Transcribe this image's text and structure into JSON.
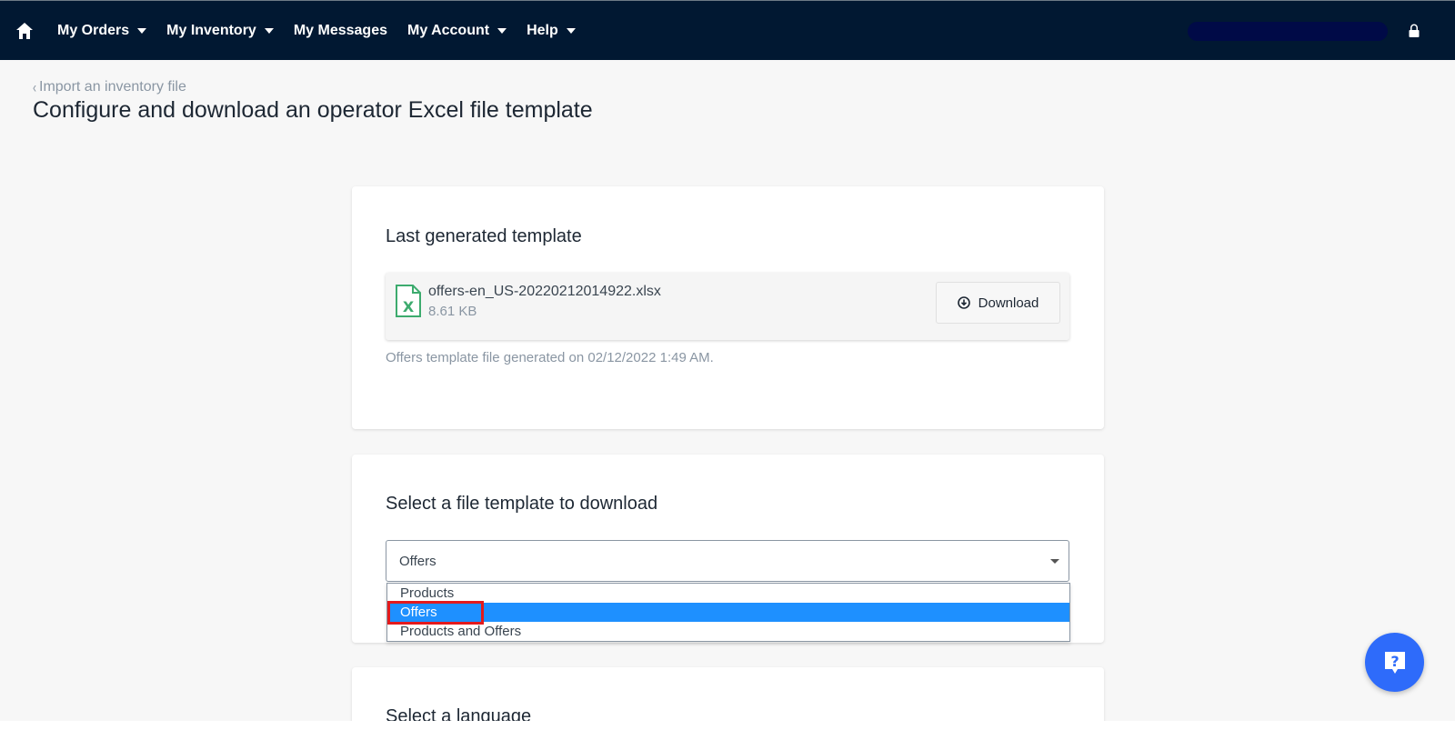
{
  "nav": {
    "items": [
      {
        "label": "My Orders",
        "dropdown": true
      },
      {
        "label": "My Inventory",
        "dropdown": true
      },
      {
        "label": "My Messages",
        "dropdown": false
      },
      {
        "label": "My Account",
        "dropdown": true
      },
      {
        "label": "Help",
        "dropdown": true
      }
    ]
  },
  "breadcrumb": {
    "back_label": "Import an inventory file"
  },
  "page": {
    "title": "Configure and download an operator Excel file template"
  },
  "last_template": {
    "title": "Last generated template",
    "file_name": "offers-en_US-20220212014922.xlsx",
    "file_size": "8.61 KB",
    "download_label": "Download",
    "generated_note": "Offers template file generated on 02/12/2022 1:49 AM."
  },
  "template_select": {
    "title": "Select a file template to download",
    "selected": "Offers",
    "options": [
      "Products",
      "Offers",
      "Products and Offers"
    ],
    "highlighted_index": 1
  },
  "language_section": {
    "title": "Select a language"
  },
  "colors": {
    "navbar": "#011832",
    "accent": "#1e90ff",
    "help_button": "#2e6bfa",
    "annotation": "#e41a1c"
  }
}
